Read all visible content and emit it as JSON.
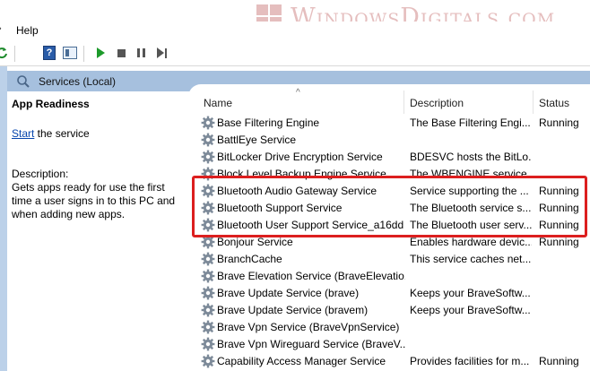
{
  "menubar": {
    "help": "Help"
  },
  "watermark": {
    "text": "WindowsDigitals.com"
  },
  "panel": {
    "title": "Services (Local)"
  },
  "details": {
    "service_name": "App Readiness",
    "start_link": "Start",
    "start_suffix": " the service",
    "description_label": "Description:",
    "description_text": "Gets apps ready for use the first time a user signs in to this PC and when adding new apps."
  },
  "columns": {
    "name": "Name",
    "description": "Description",
    "status": "Status"
  },
  "services": [
    {
      "name": "Base Filtering Engine",
      "description": "The Base Filtering Engi...",
      "status": "Running"
    },
    {
      "name": "BattlEye Service",
      "description": "",
      "status": ""
    },
    {
      "name": "BitLocker Drive Encryption Service",
      "description": "BDESVC hosts the BitLo...",
      "status": ""
    },
    {
      "name": "Block Level Backup Engine Service",
      "description": "The WBENGINE service ...",
      "status": ""
    },
    {
      "name": "Bluetooth Audio Gateway Service",
      "description": "Service supporting the ...",
      "status": "Running"
    },
    {
      "name": "Bluetooth Support Service",
      "description": "The Bluetooth service s...",
      "status": "Running"
    },
    {
      "name": "Bluetooth User Support Service_a16dd",
      "description": "The Bluetooth user serv...",
      "status": "Running"
    },
    {
      "name": "Bonjour Service",
      "description": "Enables hardware devic...",
      "status": "Running"
    },
    {
      "name": "BranchCache",
      "description": "This service caches net...",
      "status": ""
    },
    {
      "name": "Brave Elevation Service (BraveElevatio...",
      "description": "",
      "status": ""
    },
    {
      "name": "Brave Update Service (brave)",
      "description": "Keeps your BraveSoftw...",
      "status": ""
    },
    {
      "name": "Brave Update Service (bravem)",
      "description": "Keeps your BraveSoftw...",
      "status": ""
    },
    {
      "name": "Brave Vpn Service (BraveVpnService)",
      "description": "",
      "status": ""
    },
    {
      "name": "Brave Vpn Wireguard Service (BraveV...",
      "description": "",
      "status": ""
    },
    {
      "name": "Capability Access Manager Service",
      "description": "Provides facilities for m...",
      "status": "Running"
    }
  ],
  "colors": {
    "header": "#a6c0de",
    "highlight": "#dc1f1f",
    "link": "#0645ad"
  }
}
